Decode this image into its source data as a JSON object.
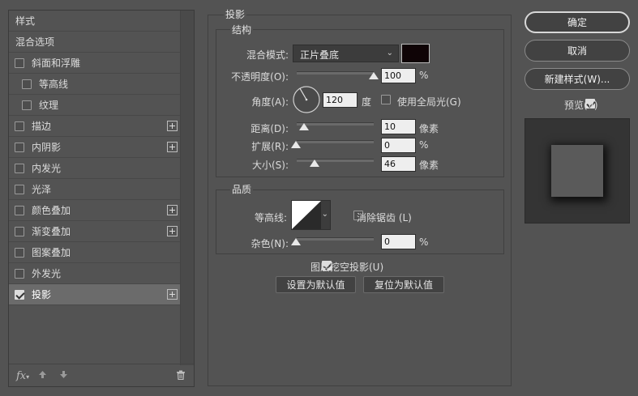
{
  "left": {
    "header_styles": "样式",
    "header_blend": "混合选项",
    "items": [
      {
        "label": "斜面和浮雕",
        "checked": false,
        "sub": false,
        "plus": false
      },
      {
        "label": "等高线",
        "checked": false,
        "sub": true,
        "plus": false
      },
      {
        "label": "纹理",
        "checked": false,
        "sub": true,
        "plus": false
      },
      {
        "label": "描边",
        "checked": false,
        "sub": false,
        "plus": true
      },
      {
        "label": "内阴影",
        "checked": false,
        "sub": false,
        "plus": true
      },
      {
        "label": "内发光",
        "checked": false,
        "sub": false,
        "plus": false
      },
      {
        "label": "光泽",
        "checked": false,
        "sub": false,
        "plus": false
      },
      {
        "label": "颜色叠加",
        "checked": false,
        "sub": false,
        "plus": true
      },
      {
        "label": "渐变叠加",
        "checked": false,
        "sub": false,
        "plus": true
      },
      {
        "label": "图案叠加",
        "checked": false,
        "sub": false,
        "plus": false
      },
      {
        "label": "外发光",
        "checked": false,
        "sub": false,
        "plus": false
      },
      {
        "label": "投影",
        "checked": true,
        "sub": false,
        "plus": true,
        "selected": true
      }
    ],
    "fx_label": "fx"
  },
  "shadow": {
    "title": "投影",
    "structure": {
      "title": "结构",
      "blend_label": "混合模式:",
      "blend_value": "正片叠底",
      "swatch_color": "#0f0406",
      "opacity_label": "不透明度(O):",
      "opacity_value": "100",
      "opacity_unit": "%",
      "angle_label": "角度(A):",
      "angle_value": "120",
      "angle_unit": "度",
      "global_light_label": "使用全局光(G)",
      "distance_label": "距离(D):",
      "distance_value": "10",
      "distance_unit": "像素",
      "spread_label": "扩展(R):",
      "spread_value": "0",
      "spread_unit": "%",
      "size_label": "大小(S):",
      "size_value": "46",
      "size_unit": "像素"
    },
    "quality": {
      "title": "品质",
      "contour_label": "等高线:",
      "antialias_label": "消除锯齿 (L)",
      "noise_label": "杂色(N):",
      "noise_value": "0",
      "noise_unit": "%"
    },
    "knockout_label": "图层挖空投影(U)",
    "make_default": "设置为默认值",
    "reset_default": "复位为默认值"
  },
  "right": {
    "ok": "确定",
    "cancel": "取消",
    "new_style": "新建样式(W)...",
    "preview_label": "预览(V)"
  }
}
